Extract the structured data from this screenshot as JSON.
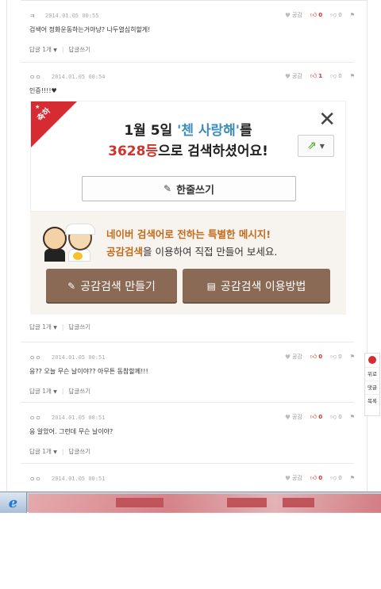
{
  "actions": {
    "like_label": "공감",
    "report_icon": "flag-icon"
  },
  "comments": [
    {
      "nick": "ㅋ",
      "date": "2014.01.05 00:55",
      "text": "검색어 정화운동하는거야냥? 나두열심히할게!",
      "up": "0",
      "down": "0",
      "replies_label": "답글",
      "replies_count": "1개",
      "write_reply": "답글쓰기"
    },
    {
      "nick": "ㅇㅇ",
      "date": "2014.01.05 00:54",
      "text": "인증!!!!♥",
      "up": "1",
      "down": "0",
      "replies_label": "답글",
      "replies_count": "1개",
      "write_reply": "답글쓰기"
    },
    {
      "nick": "ㅇㅇ",
      "date": "2014.01.05 00:51",
      "text": "응?? 오늘 무슨 날이야?? 아무튼 동참할께!!!",
      "up": "0",
      "down": "0",
      "replies_label": "답글",
      "replies_count": "1개",
      "write_reply": "답글쓰기"
    },
    {
      "nick": "ㅇㅇ",
      "date": "2014.01.05 00:51",
      "text": "응 알았어. 그런데 무슨 날이야?",
      "up": "0",
      "down": "0",
      "replies_label": "답글",
      "replies_count": "1개",
      "write_reply": "답글쓰기"
    },
    {
      "nick": "ㅇㅇ",
      "date": "2014.01.05 00:51",
      "text": "",
      "up": "0",
      "down": "0"
    }
  ],
  "ad": {
    "ribbon": "축하",
    "line1_pre": "1월 5일 ",
    "line1_highlight": "'첸 사랑해'",
    "line1_post": "를",
    "line2_rank": "3628등",
    "line2_post": "으로 검색하셨어요!",
    "write_label": "한줄쓰기",
    "msg1": "네이버 검색어로 전하는 특별한 메시지!",
    "msg2_highlight": "공감검색",
    "msg2_rest": "을 이용하여 직접 만들어 보세요.",
    "btn_make": "공감검색 만들기",
    "btn_how": "공감검색 이용방법"
  },
  "float_menu": {
    "top": "위로",
    "reply": "댓글",
    "list": "목록"
  },
  "colors": {
    "accent_red": "#d72b33",
    "brown_button": "#8a6a55",
    "highlight_blue": "#3c8dbc",
    "orange_text": "#c66a1a"
  }
}
